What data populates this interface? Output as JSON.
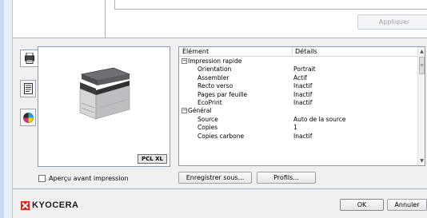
{
  "top": {
    "apply_label": "Appliquer"
  },
  "preview": {
    "pdl_badge": "PCL XL",
    "checkbox_label": "Aperçu avant impression"
  },
  "list": {
    "col_element": "Élément",
    "col_details": "Détails",
    "rows": [
      {
        "type": "group",
        "label": "Impression rapide",
        "value": ""
      },
      {
        "type": "item",
        "label": "Orientation",
        "value": "Portrait"
      },
      {
        "type": "item",
        "label": "Assembler",
        "value": "Actif"
      },
      {
        "type": "item",
        "label": "Recto verso",
        "value": "Inactif"
      },
      {
        "type": "item",
        "label": "Pages par feuille",
        "value": "Inactif"
      },
      {
        "type": "item",
        "label": "EcoPrint",
        "value": "Inactif"
      },
      {
        "type": "group",
        "label": "Général",
        "value": ""
      },
      {
        "type": "item",
        "label": "Source",
        "value": "Auto de la source"
      },
      {
        "type": "item",
        "label": "Copies",
        "value": "1"
      },
      {
        "type": "item",
        "label": "Copies carbone",
        "value": "Inactif"
      }
    ]
  },
  "buttons": {
    "save_as": "Enregistrer sous...",
    "profiles": "Profils...",
    "ok": "OK",
    "cancel": "Annuler"
  },
  "brand": {
    "name": "KYOCERA",
    "color": "#d7281f"
  }
}
